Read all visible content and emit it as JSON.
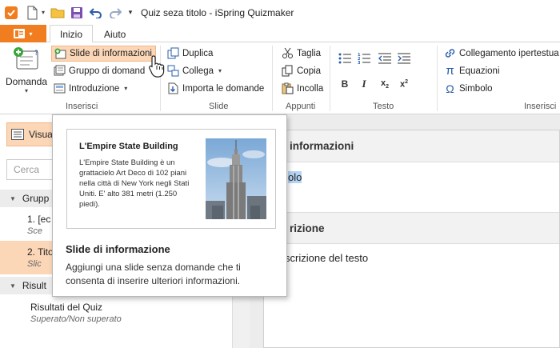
{
  "window_title": "Quiz seza titolo - iSpring Quizmaker",
  "tabs": [
    "Inizio",
    "Aiuto"
  ],
  "ribbon": {
    "domanda": "Domanda",
    "slide_informazioni": "Slide di informazioni",
    "gruppo_domande": "Gruppo di domand",
    "introduzione": "Introduzione",
    "duplica": "Duplica",
    "collega": "Collega",
    "importa": "Importa le domande",
    "taglia": "Taglia",
    "copia": "Copia",
    "incolla": "Incolla",
    "collegamento": "Collegamento ipertestua",
    "equazioni": "Equazioni",
    "simbolo": "Simbolo",
    "groups": {
      "inserisci": "Inserisci",
      "slide": "Slide",
      "appunti": "Appunti",
      "testo": "Testo",
      "inserisci2": "Inserisci"
    }
  },
  "left": {
    "visual_label": "Visua",
    "search_placeholder": "Cerca",
    "tree": {
      "gruppo": "Grupp",
      "item1_title": "1. [ec",
      "item1_sub": "Sce",
      "item2_title": "2. Tito",
      "item2_sub": "Slic",
      "risultati_group": "Risult",
      "risultati_title": "Risultati del Quiz",
      "risultati_sub": "Superato/Non superato"
    }
  },
  "editor": {
    "header1": "informazioni",
    "selected_text": "olo",
    "header2": "rizione",
    "body_text": "scrizione del testo"
  },
  "tooltip": {
    "preview_title": "L'Empire State Building",
    "preview_body": "L'Empire State Building è un grattacielo Art Deco di 102 piani nella città di New York negli Stati Uniti. E' alto 381 metri (1.250 piedi).",
    "title": "Slide di informazione",
    "description": "Aggiungi una slide senza domande che ti consenta di inserire ulteriori informazioni."
  },
  "colors": {
    "accent": "#f07d1f",
    "highlight": "#fbd7b8",
    "selection": "#b5d4f4",
    "icon_blue": "#2a5caa"
  }
}
